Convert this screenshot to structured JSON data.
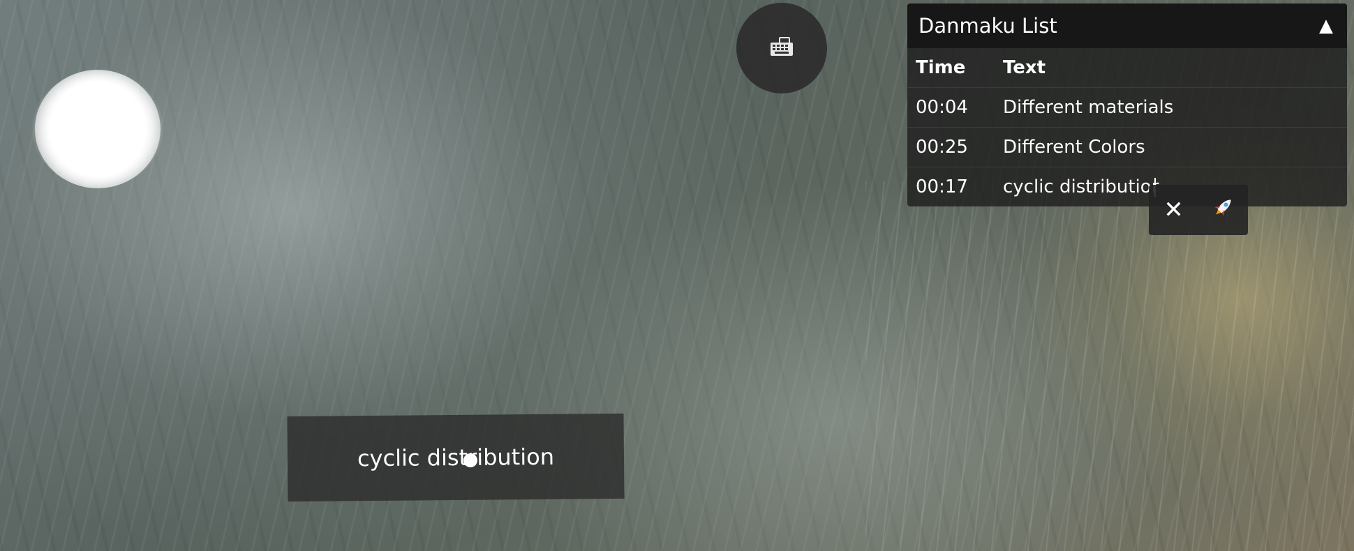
{
  "keyboard_toggle": {
    "icon": "keyboard-icon"
  },
  "danmaku_panel": {
    "title": "Danmaku List",
    "collapse_icon": "▲",
    "columns": {
      "time": "Time",
      "text": "Text"
    },
    "rows": [
      {
        "time": "00:04",
        "text": "Different materials"
      },
      {
        "time": "00:25",
        "text": "Different Colors"
      },
      {
        "time": "00:17",
        "text": "cyclic distributior"
      }
    ]
  },
  "edit_actions": {
    "cancel_icon": "✕",
    "send_icon": "rocket-icon"
  },
  "floating_danmaku": {
    "text": "cyclic distribution"
  }
}
